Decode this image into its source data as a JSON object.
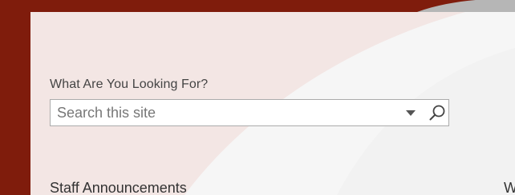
{
  "search": {
    "label": "What Are You Looking For?",
    "placeholder": "Search this site",
    "value": ""
  },
  "sections": {
    "left_heading": "Staff Announcements",
    "right_heading_partial": "W"
  },
  "icons": {
    "scope": "chevron-down-icon",
    "search": "search-icon"
  },
  "colors": {
    "frame": "#7f1c0c",
    "panel_tint": "#f3e6e4",
    "panel_light": "#f6f6f6",
    "border": "#ababab",
    "text": "#444444"
  }
}
